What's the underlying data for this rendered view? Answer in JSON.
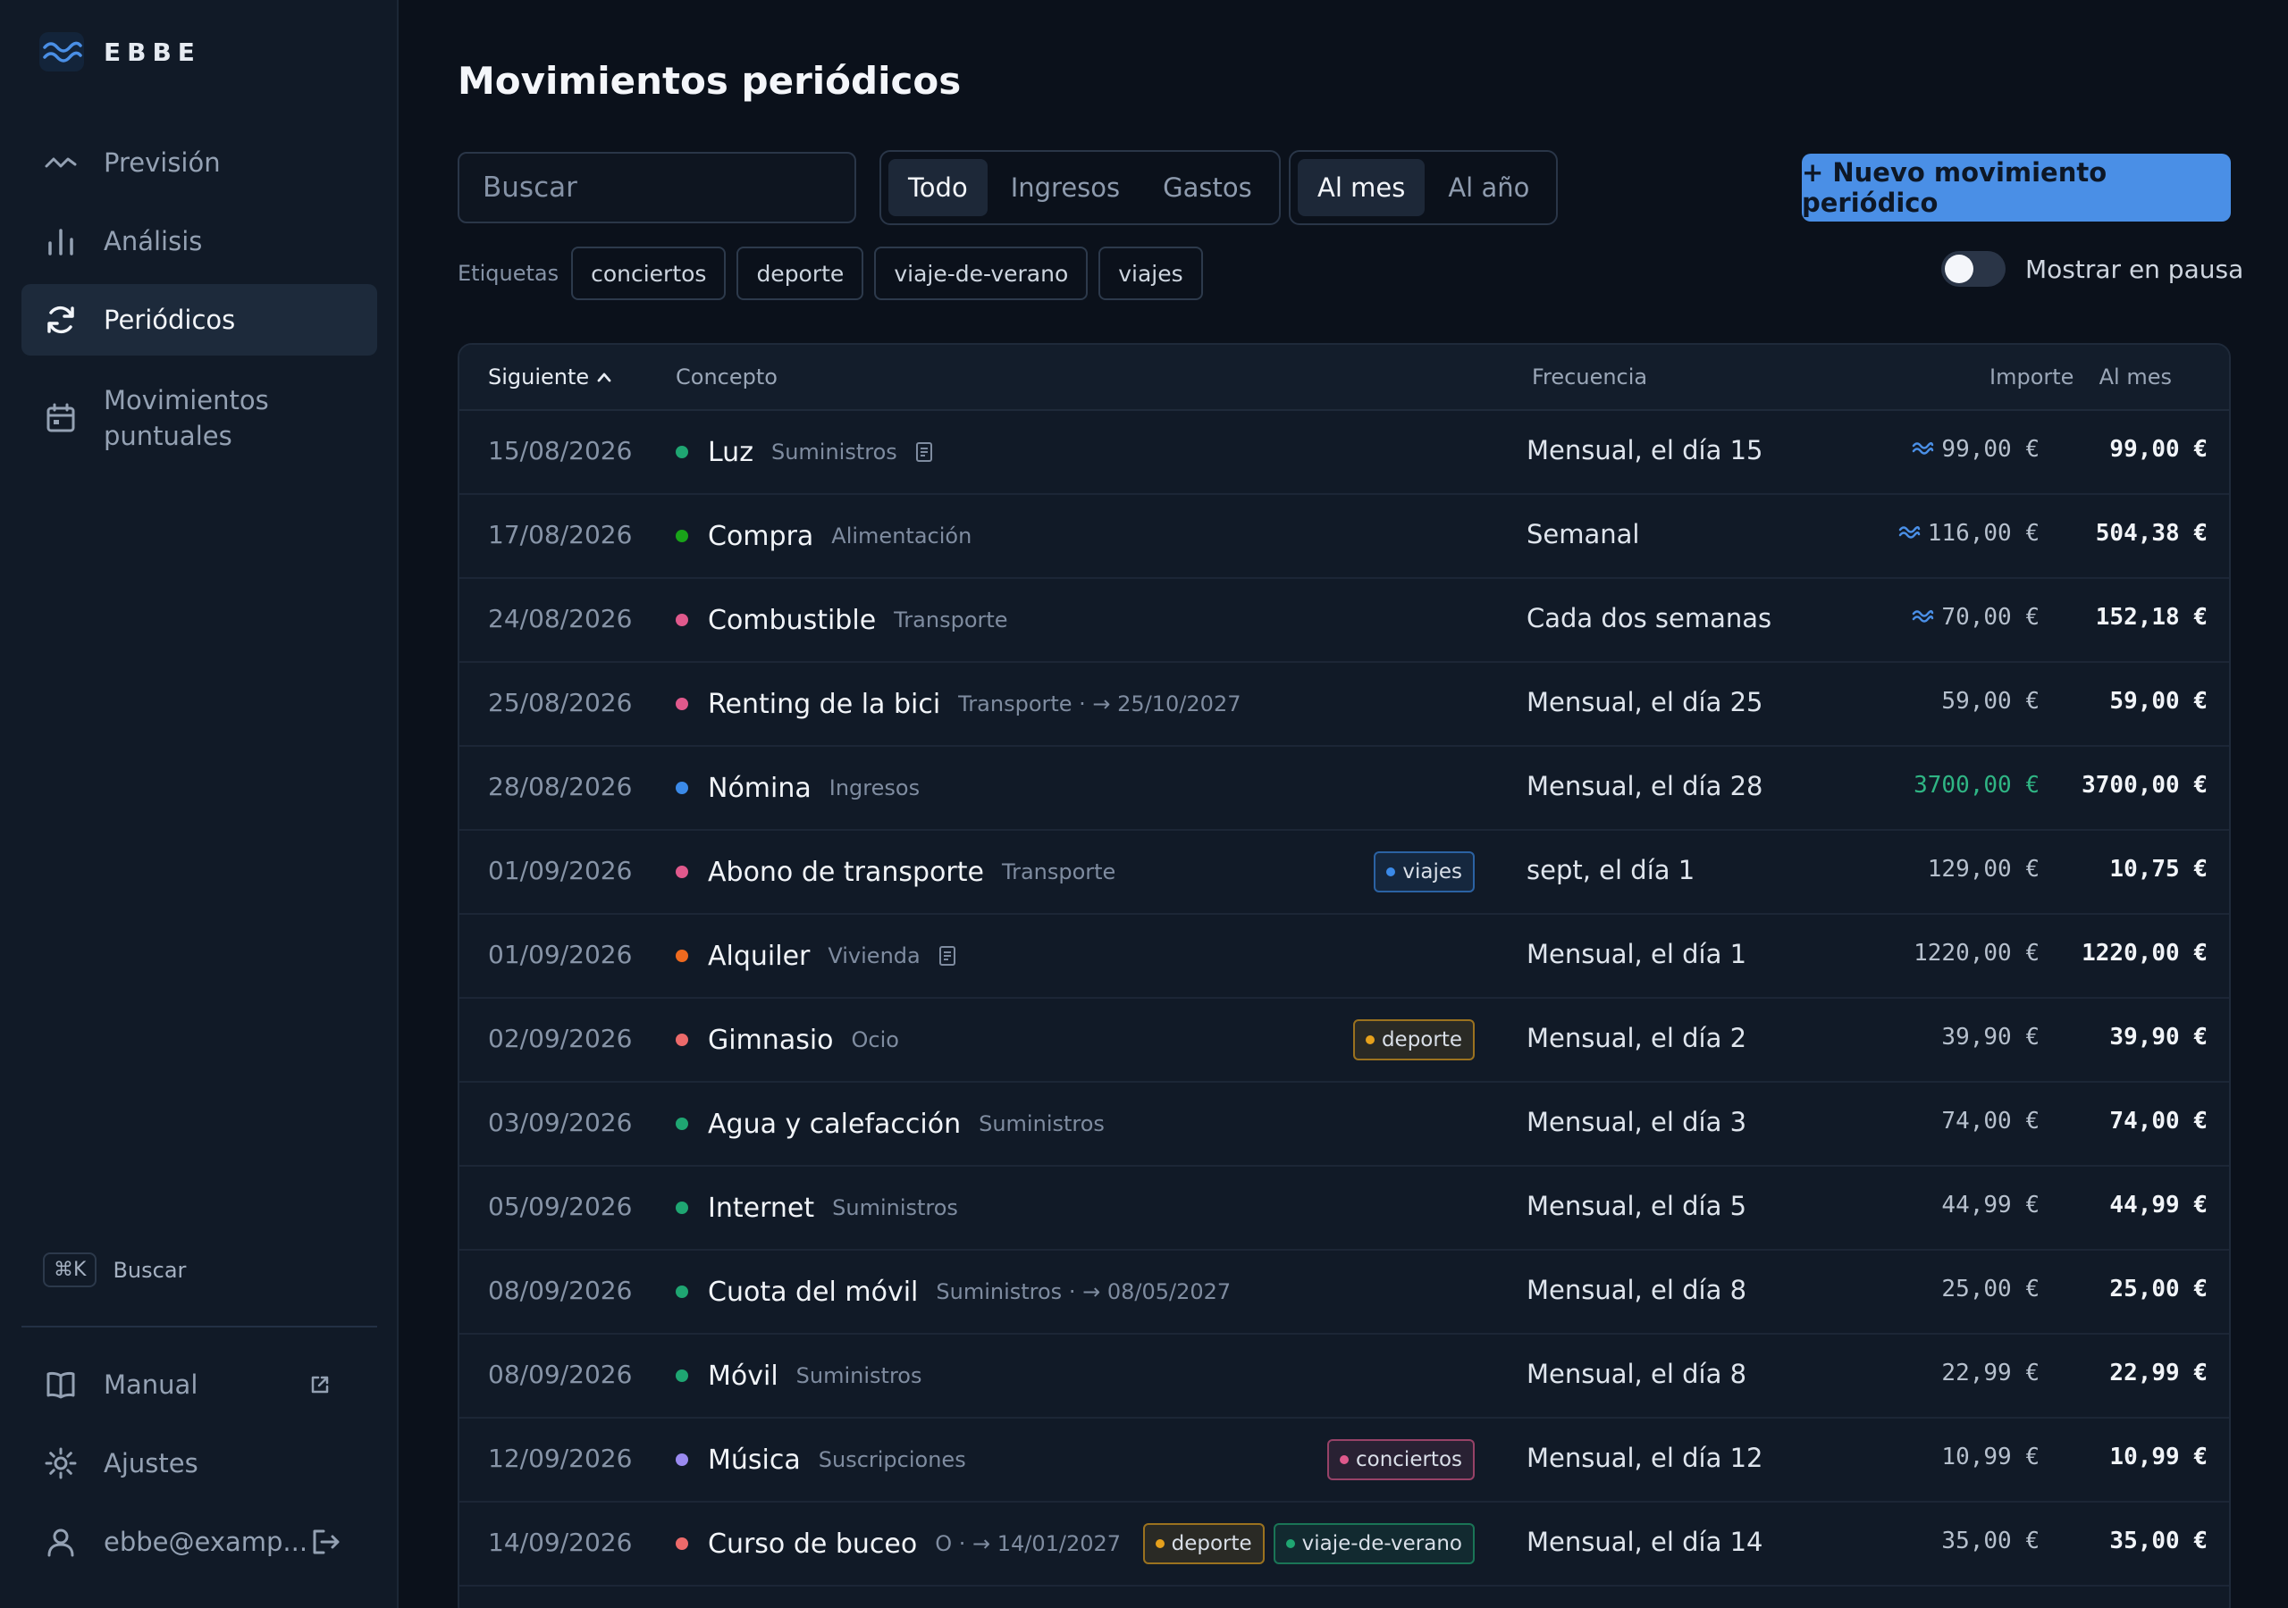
{
  "app": {
    "brand": "EBBE"
  },
  "sidebar": {
    "items": [
      {
        "label": "Previsión",
        "icon": "trend-icon"
      },
      {
        "label": "Análisis",
        "icon": "bar-chart-icon"
      },
      {
        "label": "Periódicos",
        "icon": "refresh-icon",
        "active": true
      },
      {
        "label": "Movimientos puntuales",
        "icon": "calendar-icon"
      }
    ],
    "shortcut_key": "⌘K",
    "shortcut_label": "Buscar",
    "manual": "Manual",
    "settings": "Ajustes",
    "user": "ebbe@examp..."
  },
  "page": {
    "title": "Movimientos periódicos",
    "search_placeholder": "Buscar",
    "type_filter": [
      "Todo",
      "Ingresos",
      "Gastos"
    ],
    "type_selected": "Todo",
    "period_filter": [
      "Al mes",
      "Al año"
    ],
    "period_selected": "Al mes",
    "new_button": "+ Nuevo movimiento periódico",
    "tags_label": "Etiquetas",
    "tags": [
      "conciertos",
      "deporte",
      "viaje-de-verano",
      "viajes"
    ],
    "show_paused_label": "Mostrar en pausa",
    "show_paused": false
  },
  "table": {
    "headers": {
      "next": "Siguiente",
      "concept": "Concepto",
      "frequency": "Frecuencia",
      "amount": "Importe",
      "monthly": "Al mes"
    },
    "rows": [
      {
        "date": "15/08/2026",
        "name": "Luz",
        "category": "Suministros",
        "dot": "#1fa672",
        "note": true,
        "frequency": "Mensual, el día 15",
        "approx": true,
        "amount": "99,00 €",
        "monthly": "99,00 €"
      },
      {
        "date": "17/08/2026",
        "name": "Compra",
        "category": "Alimentación",
        "dot": "#19a319",
        "frequency": "Semanal",
        "approx": true,
        "amount": "116,00 €",
        "monthly": "504,38 €"
      },
      {
        "date": "24/08/2026",
        "name": "Combustible",
        "category": "Transporte",
        "dot": "#e0598c",
        "frequency": "Cada dos semanas",
        "approx": true,
        "amount": "70,00 €",
        "monthly": "152,18 €"
      },
      {
        "date": "25/08/2026",
        "name": "Renting de la bici",
        "category": "Transporte · → 25/10/2027",
        "dot": "#e0598c",
        "frequency": "Mensual, el día 25",
        "amount": "59,00 €",
        "monthly": "59,00 €"
      },
      {
        "date": "28/08/2026",
        "name": "Nómina",
        "category": "Ingresos",
        "dot": "#3b8ae8",
        "frequency": "Mensual, el día 28",
        "amount": "3700,00 €",
        "income": true,
        "monthly": "3700,00 €"
      },
      {
        "date": "01/09/2026",
        "name": "Abono de transporte",
        "category": "Transporte",
        "dot": "#e0598c",
        "tags": [
          {
            "label": "viajes",
            "color": "#3b8ae8"
          }
        ],
        "frequency": "sept, el día 1",
        "amount": "129,00 €",
        "monthly": "10,75 €"
      },
      {
        "date": "01/09/2026",
        "name": "Alquiler",
        "category": "Vivienda",
        "dot": "#ee6a1f",
        "note": true,
        "frequency": "Mensual, el día 1",
        "amount": "1220,00 €",
        "monthly": "1220,00 €"
      },
      {
        "date": "02/09/2026",
        "name": "Gimnasio",
        "category": "Ocio",
        "dot": "#ec6a6a",
        "tags": [
          {
            "label": "deporte",
            "color": "#e6a11c"
          }
        ],
        "frequency": "Mensual, el día 2",
        "amount": "39,90 €",
        "monthly": "39,90 €"
      },
      {
        "date": "03/09/2026",
        "name": "Agua y calefacción",
        "category": "Suministros",
        "dot": "#1fa672",
        "frequency": "Mensual, el día 3",
        "amount": "74,00 €",
        "monthly": "74,00 €"
      },
      {
        "date": "05/09/2026",
        "name": "Internet",
        "category": "Suministros",
        "dot": "#1fa672",
        "frequency": "Mensual, el día 5",
        "amount": "44,99 €",
        "monthly": "44,99 €"
      },
      {
        "date": "08/09/2026",
        "name": "Cuota del móvil",
        "category": "Suministros · → 08/05/2027",
        "dot": "#1fa672",
        "frequency": "Mensual, el día 8",
        "amount": "25,00 €",
        "monthly": "25,00 €"
      },
      {
        "date": "08/09/2026",
        "name": "Móvil",
        "category": "Suministros",
        "dot": "#1fa672",
        "frequency": "Mensual, el día 8",
        "amount": "22,99 €",
        "monthly": "22,99 €"
      },
      {
        "date": "12/09/2026",
        "name": "Música",
        "category": "Suscripciones",
        "dot": "#9a8af0",
        "tags": [
          {
            "label": "conciertos",
            "color": "#e0598c"
          }
        ],
        "frequency": "Mensual, el día 12",
        "amount": "10,99 €",
        "monthly": "10,99 €"
      },
      {
        "date": "14/09/2026",
        "name": "Curso de buceo",
        "category": "O · → 14/01/2027",
        "dot": "#ec6a6a",
        "tags": [
          {
            "label": "deporte",
            "color": "#e6a11c"
          },
          {
            "label": "viaje-de-verano",
            "color": "#1fa672"
          }
        ],
        "frequency": "Mensual, el día 14",
        "amount": "35,00 €",
        "monthly": "35,00 €"
      }
    ]
  },
  "colors": {
    "accent": "#4a8fe6",
    "income": "#2fb584",
    "background": "#0b111b",
    "sidebar": "#111a27"
  }
}
